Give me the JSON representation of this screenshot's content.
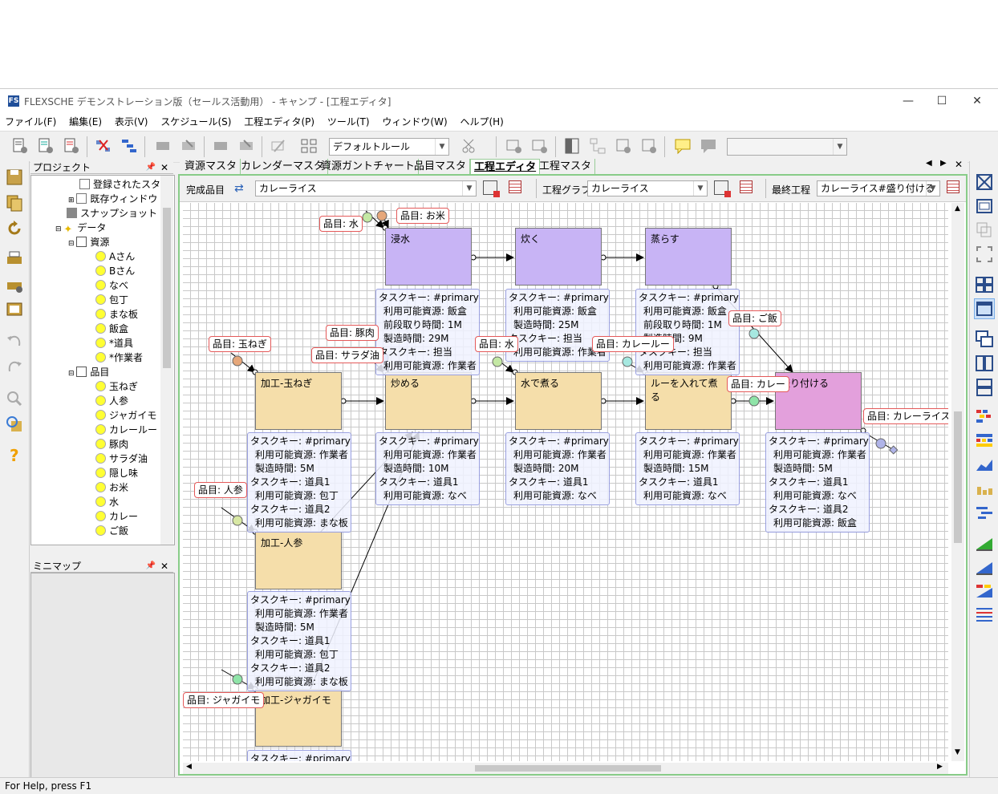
{
  "window": {
    "title": "FLEXSCHE デモンストレーション版（セールス活動用） - キャンプ - [工程エディタ]",
    "logo": "FS"
  },
  "menu": [
    "ファイル(F)",
    "編集(E)",
    "表示(V)",
    "スケジュール(S)",
    "工程エディタ(P)",
    "ツール(T)",
    "ウィンドウ(W)",
    "ヘルプ(H)"
  ],
  "toolbar": {
    "rule_combo": "デフォルトルール"
  },
  "project_panel": {
    "title": "プロジェクト",
    "items": [
      "登録されたスタイ",
      "既存ウィンドウ",
      "スナップショット",
      "データ",
      "資源",
      "Aさん",
      "Bさん",
      "なべ",
      "包丁",
      "まな板",
      "飯盒",
      "*道具",
      "*作業者",
      "品目",
      "玉ねぎ",
      "人参",
      "ジャガイモ",
      "カレールー",
      "豚肉",
      "サラダ油",
      "隠し味",
      "お米",
      "水",
      "カレー",
      "ご飯"
    ]
  },
  "minimap_panel": {
    "title": "ミニマップ"
  },
  "tabs": [
    "資源マスタ",
    "カレンダーマスタ",
    "資源ガントチャート",
    "品目マスタ",
    "工程エディタ",
    "工程マスタ"
  ],
  "active_tab": "工程エディタ",
  "editor_toolbar": {
    "finished_item_label": "完成品目",
    "finished_item_value": "カレーライス",
    "process_graph_label": "工程グラフ",
    "process_graph_value": "カレーライス",
    "final_process_label": "最終工程",
    "final_process_value": "カレーライス#盛り付ける"
  },
  "processes": {
    "soak": "浸水",
    "cook": "炊く",
    "steam": "蒸らす",
    "onion": "加工-玉ねぎ",
    "fry": "炒める",
    "boil": "水で煮る",
    "roux": "ルーを入れて煮る",
    "serve": "盛り付ける",
    "carrot": "加工-人参",
    "potato": "加工-ジャガイモ"
  },
  "colors": {
    "rice": "#c8b4f5",
    "curry": "#f5deaa",
    "final": "#e3a0dc"
  },
  "tasks": {
    "soak": [
      "タスクキー: #primary",
      "利用可能資源: 飯盒",
      "前段取り時間: 1M",
      "製造時間: 29M",
      "タスクキー: 担当",
      "利用可能資源: 作業者"
    ],
    "cook": [
      "タスクキー: #primary",
      "利用可能資源: 飯盒",
      "製造時間: 25M",
      "タスクキー: 担当",
      "利用可能資源: 作業者"
    ],
    "steam": [
      "タスクキー: #primary",
      "利用可能資源: 飯盒",
      "前段取り時間: 1M",
      "製造時間: 9M",
      "タスクキー: 担当",
      "利用可能資源: 作業者"
    ],
    "onion": [
      "タスクキー: #primary",
      "利用可能資源: 作業者",
      "製造時間: 5M",
      "タスクキー: 道具1",
      "利用可能資源: 包丁",
      "タスクキー: 道具2",
      "利用可能資源: まな板"
    ],
    "fry": [
      "タスクキー: #primary",
      "利用可能資源: 作業者",
      "製造時間: 10M",
      "タスクキー: 道具1",
      "利用可能資源: なべ"
    ],
    "boil": [
      "タスクキー: #primary",
      "利用可能資源: 作業者",
      "製造時間: 20M",
      "タスクキー: 道具1",
      "利用可能資源: なべ"
    ],
    "roux": [
      "タスクキー: #primary",
      "利用可能資源: 作業者",
      "製造時間: 15M",
      "タスクキー: 道具1",
      "利用可能資源: なべ"
    ],
    "serve": [
      "タスクキー: #primary",
      "利用可能資源: 作業者",
      "製造時間: 5M",
      "タスクキー: 道具1",
      "利用可能資源: なべ",
      "タスクキー: 道具2",
      "利用可能資源: 飯盒"
    ],
    "carrot": [
      "タスクキー: #primary",
      "利用可能資源: 作業者",
      "製造時間: 5M",
      "タスクキー: 道具1",
      "利用可能資源: 包丁",
      "タスクキー: 道具2",
      "利用可能資源: まな板"
    ],
    "potato_partial": "タスクキー: #primary"
  },
  "item_labels": {
    "water1": "品目: 水",
    "rice": "品目: お米",
    "onion": "品目: 玉ねぎ",
    "pork": "品目: 豚肉",
    "oil": "品目: サラダ油",
    "water2": "品目: 水",
    "roux": "品目: カレールー",
    "gohan": "品目: ご飯",
    "curry": "品目: カレー",
    "curryrice": "品目: カレーライス",
    "carrot": "品目: 人参",
    "potato": "品目: ジャガイモ"
  },
  "status": {
    "help": "For Help, press F1"
  }
}
